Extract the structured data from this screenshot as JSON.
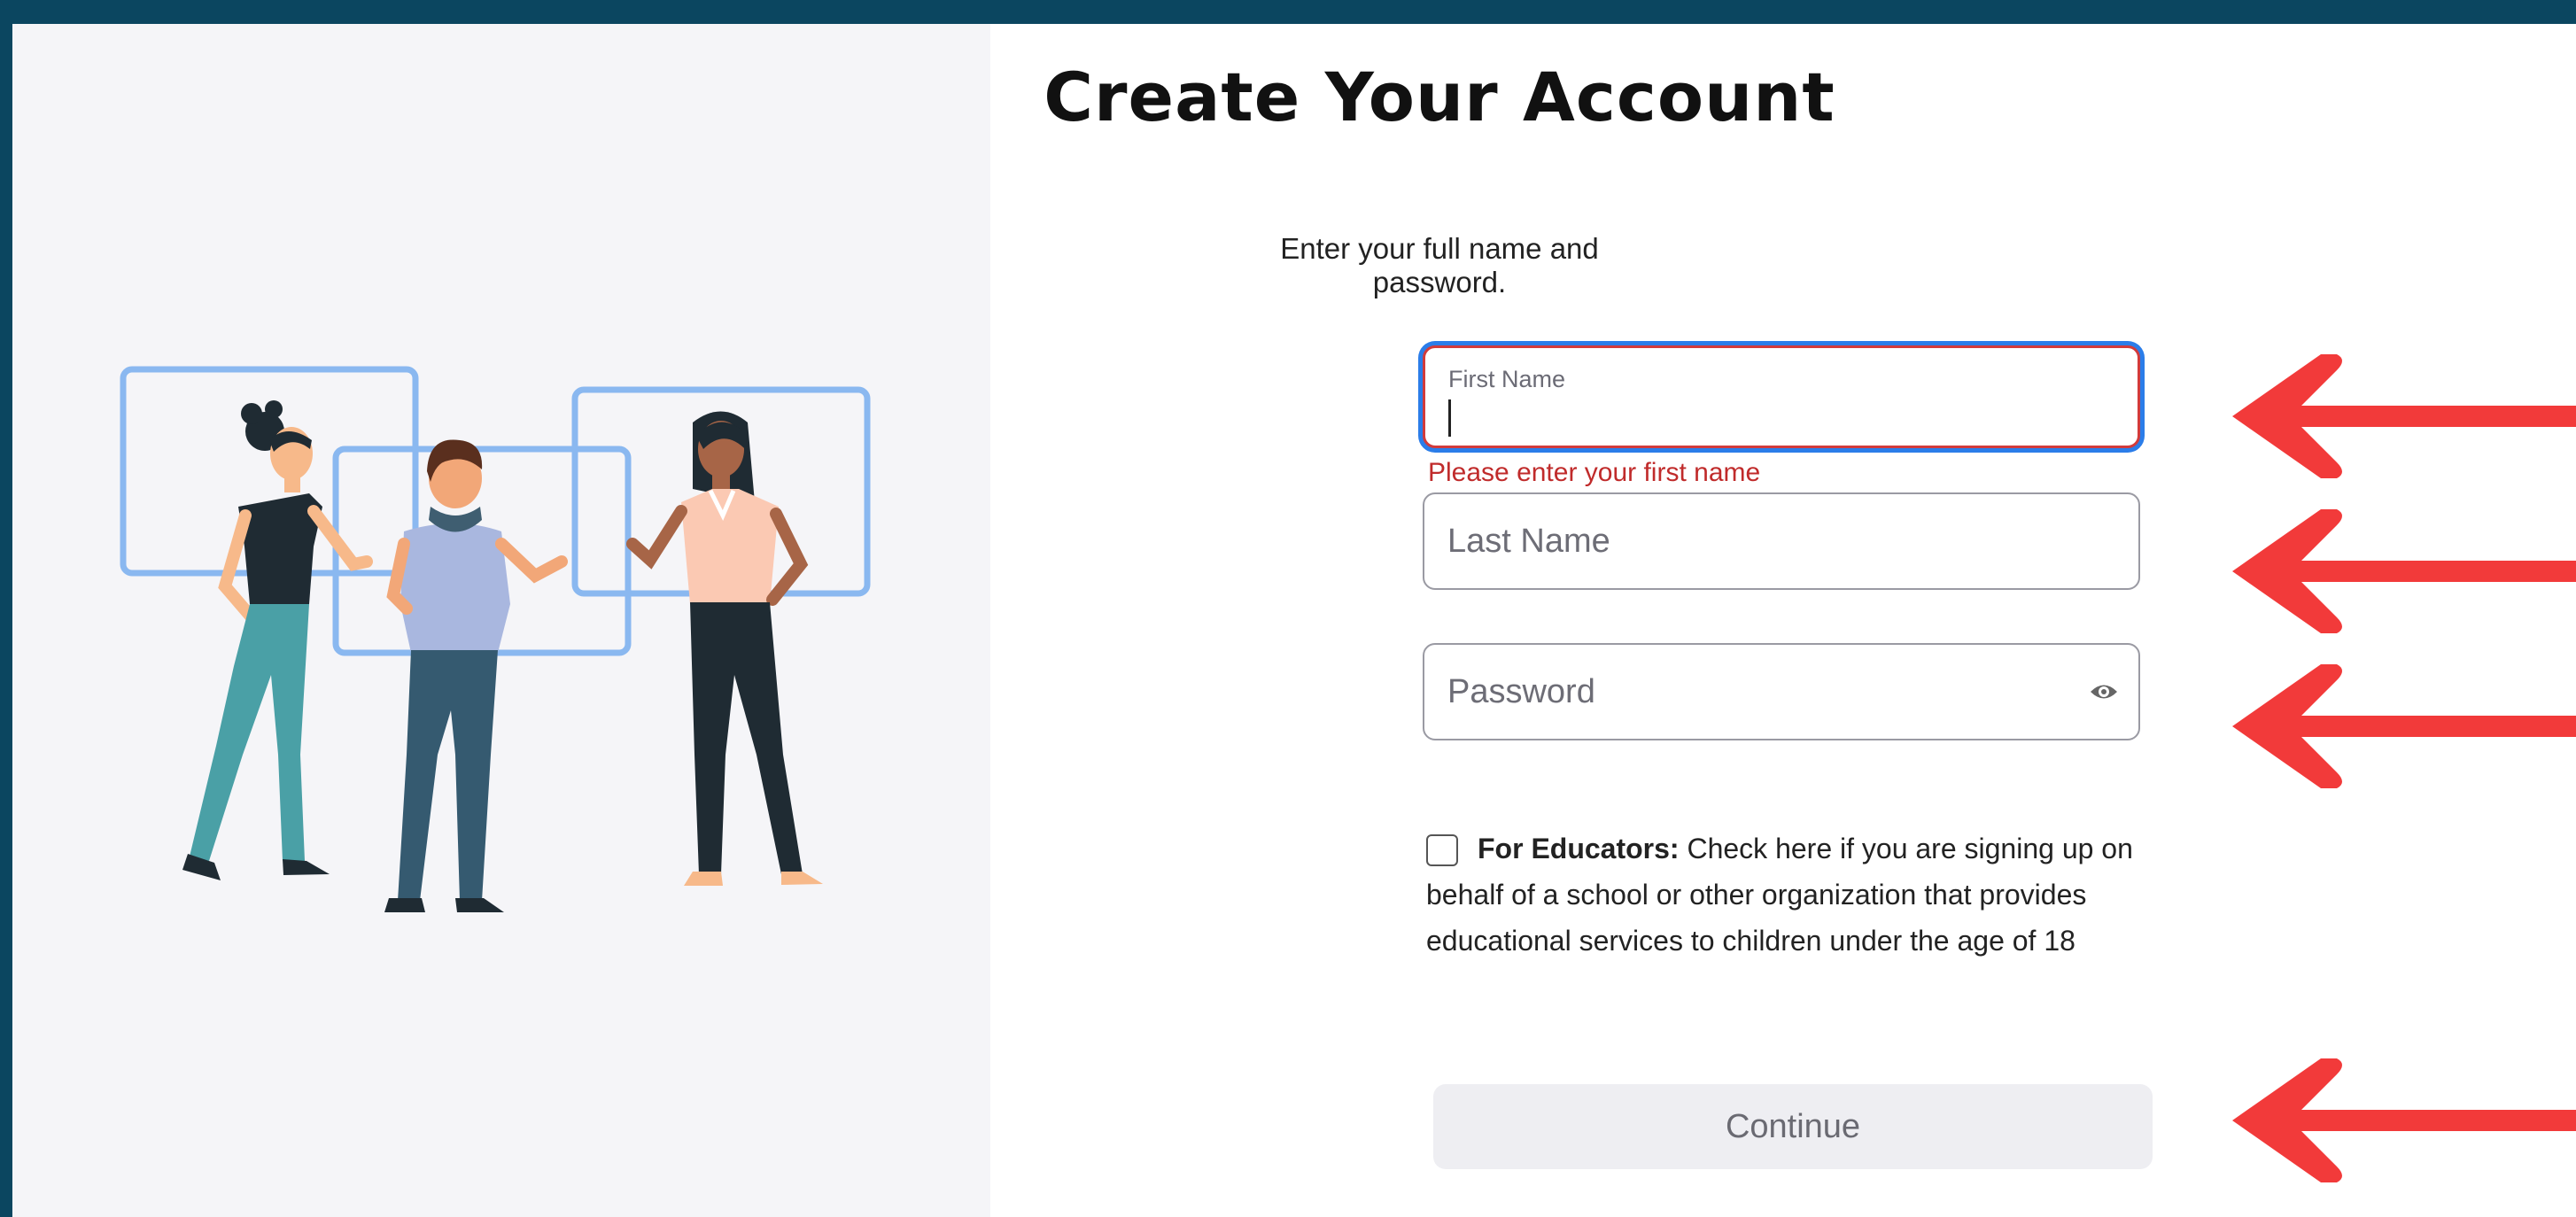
{
  "page": {
    "title": "Create Your Account",
    "subtitle": "Enter your full name and password."
  },
  "form": {
    "first_name": {
      "label": "First Name",
      "value": "",
      "error": "Please enter your first name",
      "state": "focused-invalid"
    },
    "last_name": {
      "placeholder": "Last Name",
      "value": ""
    },
    "password": {
      "placeholder": "Password",
      "value": "",
      "icon": "eye-icon"
    },
    "educators": {
      "checked": false,
      "label_bold": "For Educators:",
      "label_text": " Check here if you are signing up on behalf of a school or other organization that provides educational services to children under the age of 18"
    },
    "continue_label": "Continue"
  },
  "annotations": {
    "arrow_color": "#f23a3a",
    "arrow_count": 4
  },
  "colors": {
    "frame": "#0b4660",
    "error": "#c02b2b",
    "focus": "#2b7de9",
    "illustration_frames": "#8ab8f0"
  }
}
